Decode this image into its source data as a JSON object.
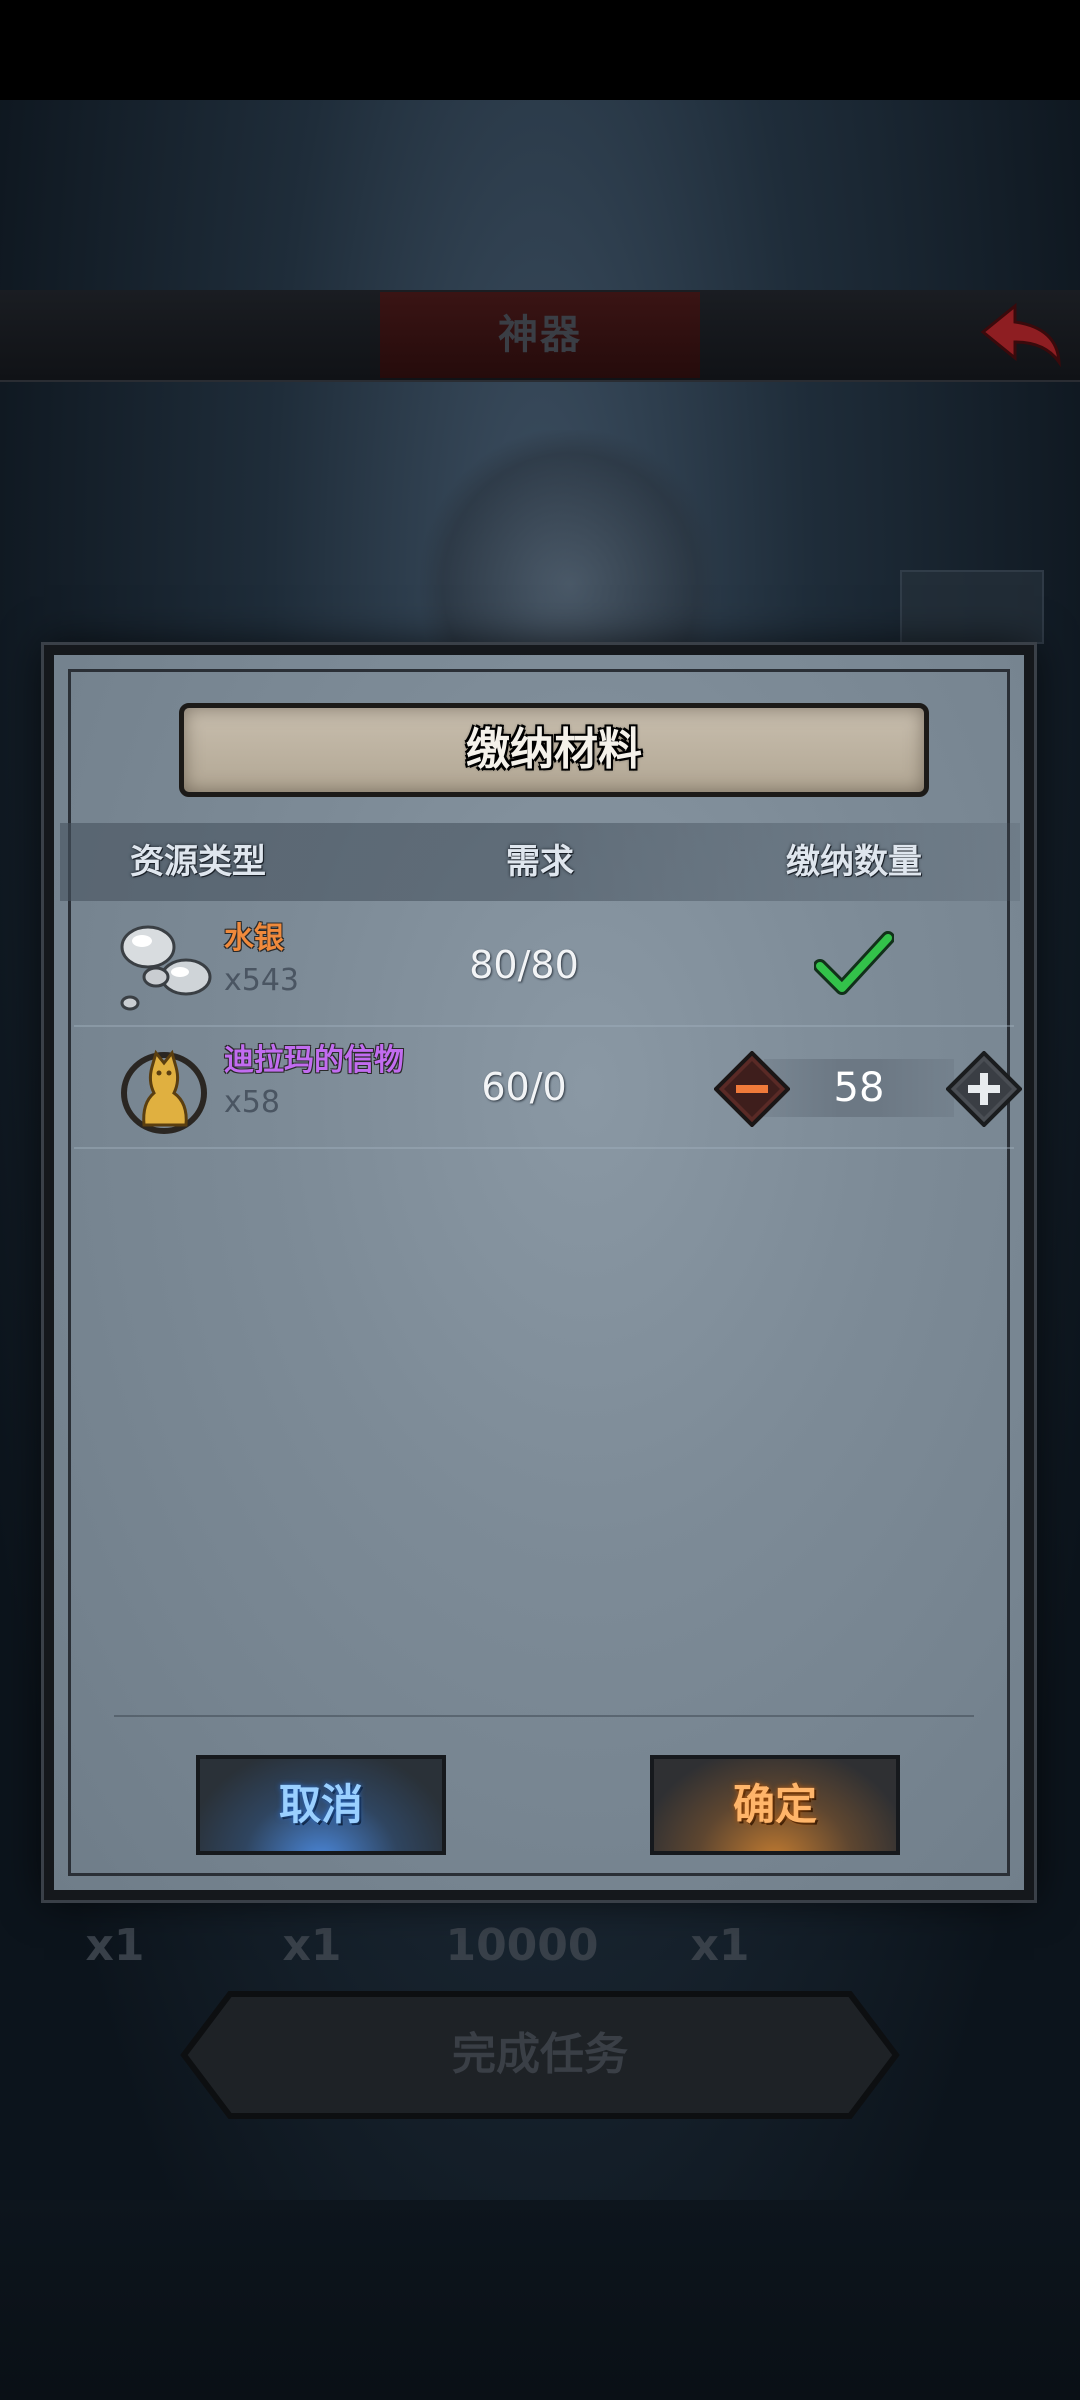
{
  "background": {
    "topbar_title": "神器",
    "counts": [
      "x1",
      "x1",
      "10000",
      "x1"
    ],
    "complete_button": "完成任务"
  },
  "modal": {
    "title": "缴纳材料",
    "headers": {
      "resource_type": "资源类型",
      "requirement": "需求",
      "submit_amount": "缴纳数量"
    },
    "items": [
      {
        "name": "水银",
        "count": "x543",
        "requirement": "80/80",
        "name_color": "#f08a3c",
        "icon": "mercury-icon",
        "status": "complete"
      },
      {
        "name": "迪拉玛的信物",
        "count": "x58",
        "requirement": "60/0",
        "name_color": "#c26cf0",
        "icon": "dilama-token-icon",
        "stepper_value": "58"
      }
    ],
    "cancel_label": "取消",
    "confirm_label": "确定"
  },
  "colors": {
    "accent_blue": "#4a86d8",
    "accent_orange": "#c07a30",
    "check_green": "#33c24a",
    "back_arrow_red": "#c4282c"
  }
}
